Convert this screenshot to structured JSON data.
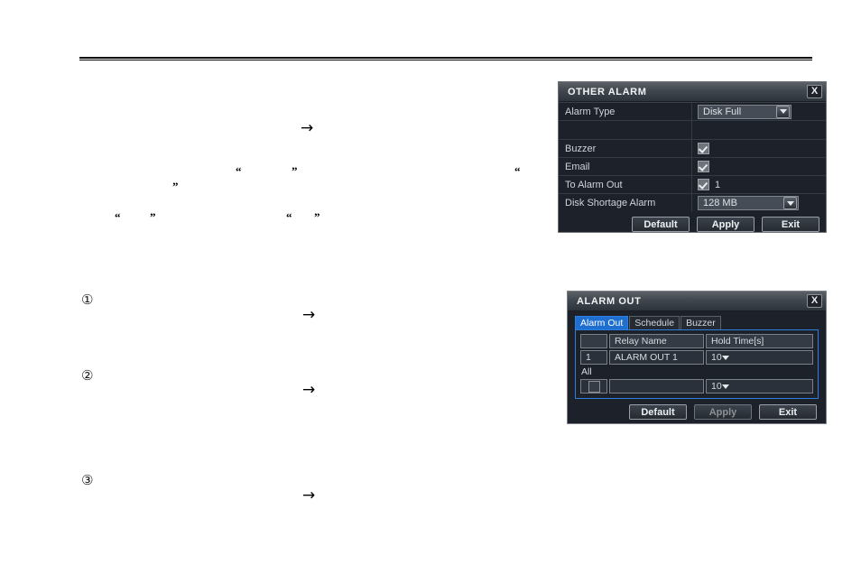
{
  "page": {
    "header_rule": true,
    "marks": {
      "arrows": [
        "→",
        "→",
        "→",
        "→"
      ],
      "open_quote": "“",
      "close_quote": "”",
      "circled_numbers": [
        "①",
        "②",
        "③"
      ]
    }
  },
  "other_alarm_dialog": {
    "title": "OTHER ALARM",
    "close_label": "X",
    "rows": [
      {
        "label": "Alarm Type",
        "type": "select",
        "value": "Disk Full"
      },
      {
        "label": "",
        "type": "spacer",
        "value": ""
      },
      {
        "label": "Buzzer",
        "type": "checkbox",
        "checked": true,
        "suffix": ""
      },
      {
        "label": "Email",
        "type": "checkbox",
        "checked": true,
        "suffix": ""
      },
      {
        "label": "To Alarm Out",
        "type": "checkbox",
        "checked": true,
        "suffix": "1"
      },
      {
        "label": "Disk Shortage Alarm",
        "type": "select",
        "value": "128 MB"
      }
    ],
    "buttons": [
      {
        "label": "Default",
        "disabled": false
      },
      {
        "label": "Apply",
        "disabled": false
      },
      {
        "label": "Exit",
        "disabled": false
      }
    ]
  },
  "alarm_out_dialog": {
    "title": "ALARM OUT",
    "close_label": "X",
    "tabs": [
      {
        "label": "Alarm Out",
        "active": true
      },
      {
        "label": "Schedule",
        "active": false
      },
      {
        "label": "Buzzer",
        "active": false
      }
    ],
    "table": {
      "headers": [
        "",
        "Relay Name",
        "Hold Time[s]"
      ],
      "rows": [
        {
          "index": "1",
          "relay_name": "ALARM OUT 1",
          "hold_time": "10"
        }
      ],
      "all_label": "All",
      "all_row": {
        "checked": false,
        "relay_name": "",
        "hold_time": "10"
      }
    },
    "buttons": [
      {
        "label": "Default",
        "disabled": false
      },
      {
        "label": "Apply",
        "disabled": true
      },
      {
        "label": "Exit",
        "disabled": false
      }
    ]
  },
  "colors": {
    "dialog_bg": "#1d2129",
    "titlebar": "#41474e",
    "accent_blue": "#1f6fd0",
    "panel_border": "#2f7fe0",
    "text": "#c9ced4",
    "page_bg": "#ffffff"
  }
}
